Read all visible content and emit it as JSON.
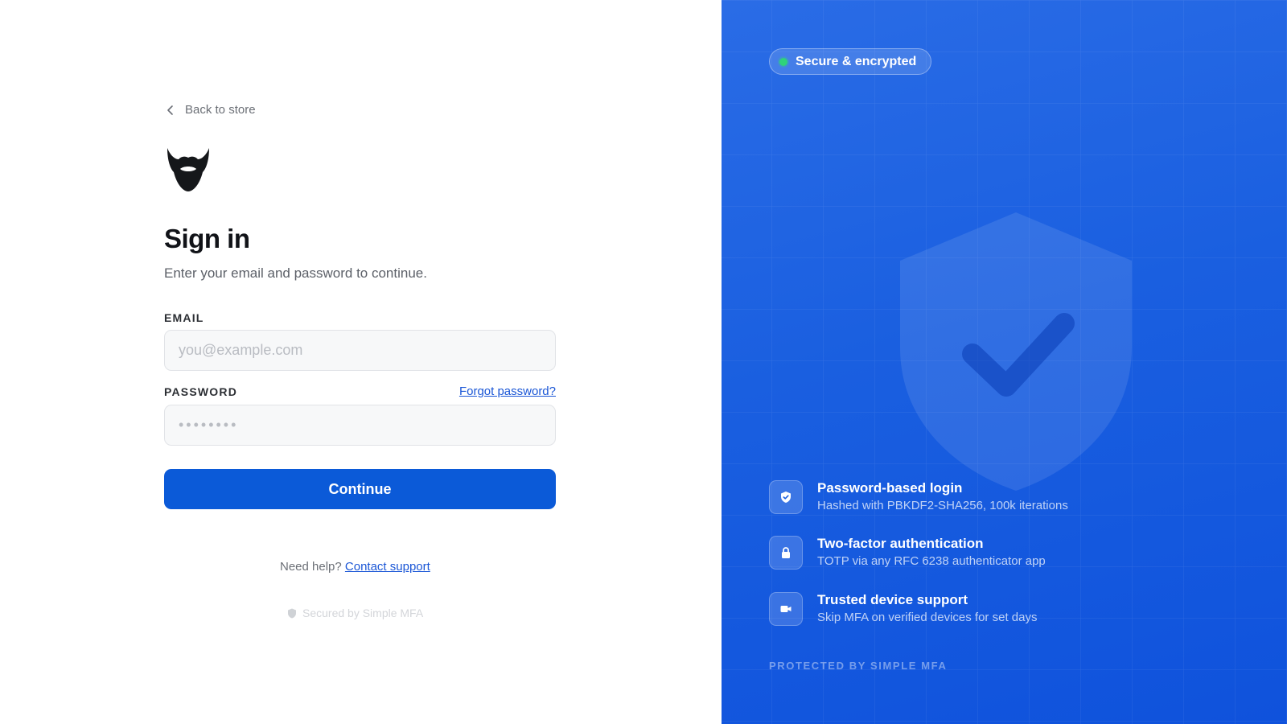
{
  "left": {
    "back_label": "Back to store",
    "logo_icon": "beard-logo-icon",
    "title": "Sign in",
    "subtitle": "Enter your email and password to continue.",
    "email": {
      "label": "EMAIL",
      "placeholder": "you@example.com",
      "value": ""
    },
    "password": {
      "label": "PASSWORD",
      "placeholder": "••••••••",
      "value": "",
      "forgot_label": "Forgot password?"
    },
    "submit_label": "Continue",
    "help": {
      "prefix": "Need help?",
      "link": "Contact support"
    },
    "secured_label": "Secured by Simple MFA"
  },
  "right": {
    "badge_label": "Secure & encrypted",
    "features": [
      {
        "icon": "shield-check-icon",
        "title": "Password-based login",
        "desc": "Hashed with PBKDF2-SHA256, 100k iterations"
      },
      {
        "icon": "lock-icon",
        "title": "Two-factor authentication",
        "desc": "TOTP via any RFC 6238 authenticator app"
      },
      {
        "icon": "video-device-icon",
        "title": "Trusted device support",
        "desc": "Skip MFA on verified devices for set days"
      }
    ],
    "footer": "PROTECTED BY SIMPLE MFA"
  },
  "colors": {
    "primary": "#0b5ad8",
    "link": "#1a56d6",
    "panel_bg": "#1a5fe0",
    "status_dot": "#2fd37a"
  }
}
